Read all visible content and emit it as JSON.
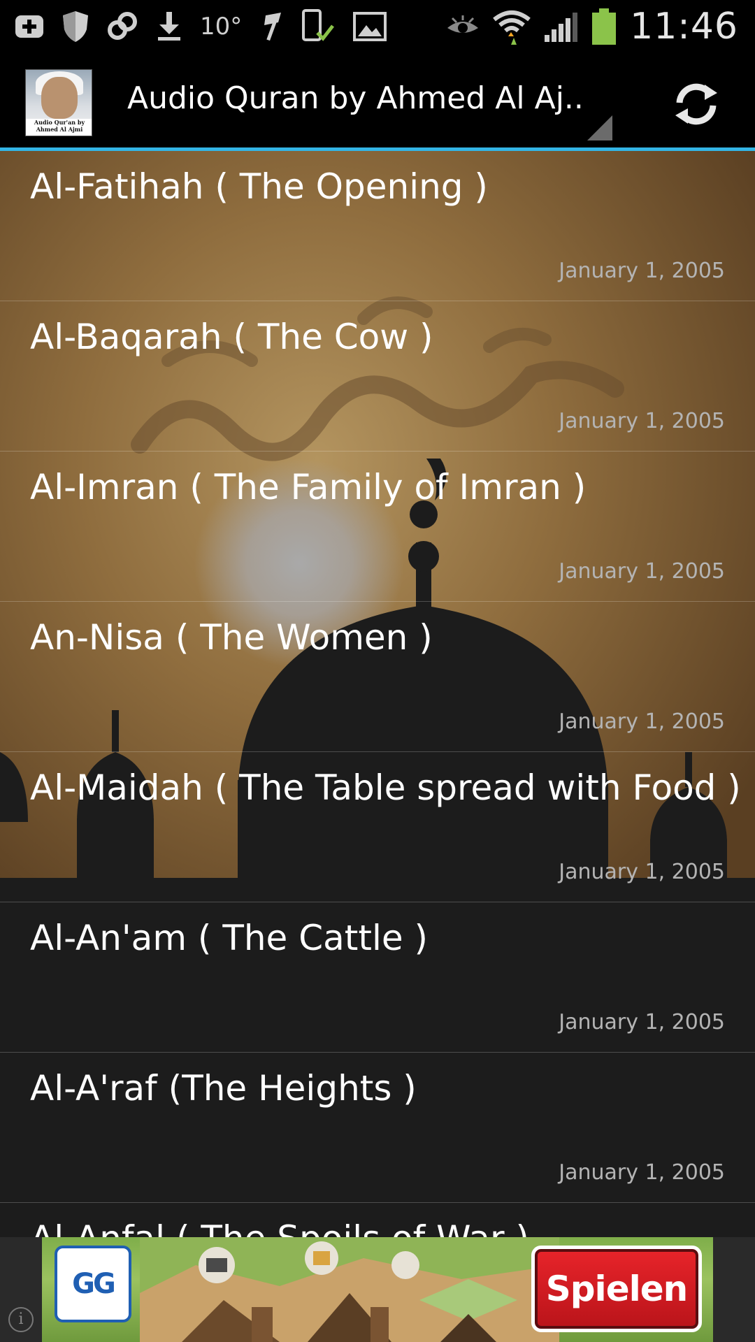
{
  "status_bar": {
    "temperature": "10°",
    "time": "11:46",
    "icons": [
      "add-icon",
      "shield-icon",
      "sync-link-icon",
      "download-icon",
      "flag-icon",
      "phone-check-icon",
      "image-icon",
      "eye-icon",
      "wifi-icon",
      "signal-icon",
      "battery-icon"
    ]
  },
  "action_bar": {
    "title": "Audio Quran by Ahmed Al Aj..",
    "app_icon_caption": "Audio Qur'an by Ahmed Al Ajmi",
    "accent_color": "#33b5e5"
  },
  "list": {
    "items": [
      {
        "title": "Al-Fatihah ( The Opening )",
        "date": "January 1, 2005"
      },
      {
        "title": "Al-Baqarah ( The Cow )",
        "date": "January 1, 2005"
      },
      {
        "title": "Al-Imran ( The Family of Imran )",
        "date": "January 1, 2005"
      },
      {
        "title": "An-Nisa ( The Women )",
        "date": "January 1, 2005"
      },
      {
        "title": "Al-Maidah ( The Table spread with Food )",
        "date": "January 1, 2005"
      },
      {
        "title": "Al-An'am ( The Cattle )",
        "date": "January 1, 2005"
      },
      {
        "title": "Al-A'raf (The Heights )",
        "date": "January 1, 2005"
      },
      {
        "title": "Al-Anfal ( The Spoils of War )",
        "date": ""
      }
    ]
  },
  "ad": {
    "logo_text": "GG",
    "cta_label": "Spielen",
    "info_symbol": "i"
  }
}
